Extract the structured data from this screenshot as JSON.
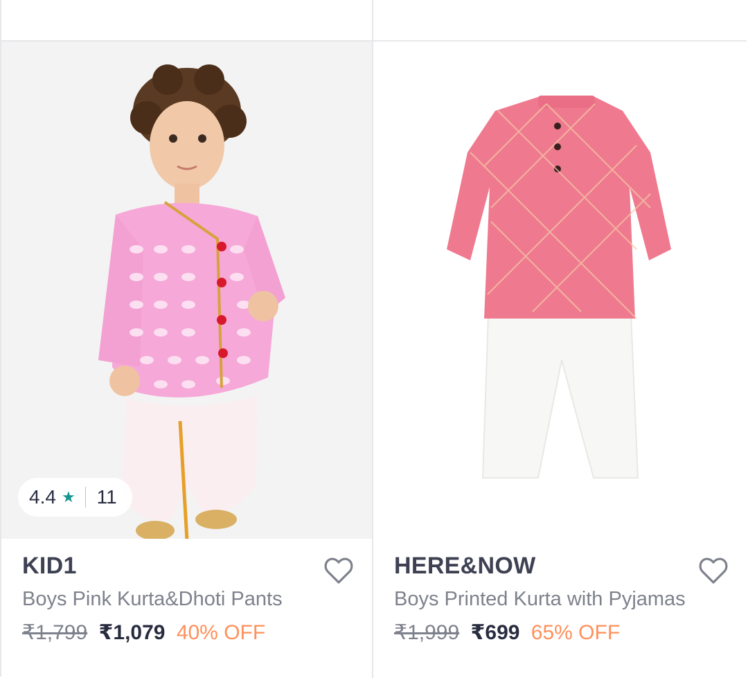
{
  "products": [
    {
      "brand": "KID1",
      "title": "Boys Pink Kurta&Dhoti Pants",
      "mrp": "₹1,799",
      "price": "₹1,079",
      "discount": "40% OFF",
      "rating": "4.4",
      "rating_count": "11",
      "image_icon": "boy-in-pink-kurta-dhoti-photo",
      "wishlist_icon": "heart-outline-icon"
    },
    {
      "brand": "HERE&NOW",
      "title": "Boys Printed Kurta with Pyjamas",
      "mrp": "₹1,999",
      "price": "₹699",
      "discount": "65% OFF",
      "image_icon": "pink-kurta-white-pyjama-photo",
      "wishlist_icon": "heart-outline-icon"
    }
  ],
  "colors": {
    "brand_text": "#3e4152",
    "muted_text": "#7e818c",
    "price_text": "#282c3f",
    "discount": "#ff905a",
    "rating_star": "#14958f",
    "divider": "#e6e7ea"
  }
}
